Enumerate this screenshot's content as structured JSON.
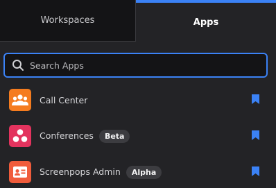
{
  "tabs": {
    "workspaces": "Workspaces",
    "apps": "Apps"
  },
  "search": {
    "placeholder": "Search Apps",
    "value": ""
  },
  "apps": [
    {
      "name": "Call Center",
      "badge": "",
      "icon": "people-group-icon",
      "color": "#f57c1f"
    },
    {
      "name": "Conferences",
      "badge": "Beta",
      "icon": "three-circles-icon",
      "color": "#e3335e"
    },
    {
      "name": "Screenpops Admin",
      "badge": "Alpha",
      "icon": "contact-card-icon",
      "color": "#f05c3b"
    }
  ],
  "colors": {
    "accent": "#3b82f6",
    "bookmark": "#3b82f6"
  }
}
